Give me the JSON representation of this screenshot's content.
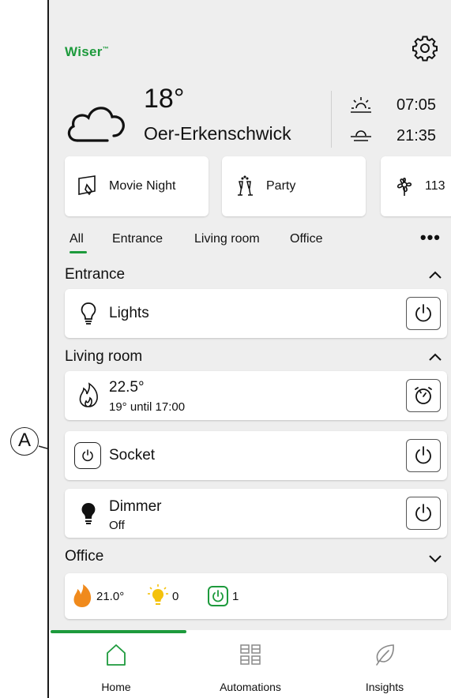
{
  "app": {
    "logo_text": "Wiser",
    "logo_tm": "™",
    "brand_color": "#1d9a3c"
  },
  "header": {
    "temperature": "18°",
    "city": "Oer-Erkenschwick",
    "sunrise": "07:05",
    "sunset": "21:35",
    "weather_icon": "cloud-icon"
  },
  "moments": [
    {
      "label": "Movie Night",
      "icon": "movie-night-icon"
    },
    {
      "label": "Party",
      "icon": "party-icon"
    },
    {
      "label": "113",
      "icon": "flower-icon"
    }
  ],
  "tabs": [
    "All",
    "Entrance",
    "Living room",
    "Office"
  ],
  "more_label": "•••",
  "sections": {
    "entrance": {
      "title": "Entrance",
      "lights": {
        "title": "Lights"
      }
    },
    "living_room": {
      "title": "Living room",
      "thermostat": {
        "title": "22.5°",
        "subtitle": "19° until 17:00"
      },
      "socket": {
        "title": "Socket"
      },
      "dimmer": {
        "title": "Dimmer",
        "subtitle": "Off"
      }
    },
    "office": {
      "title": "Office",
      "heating": "21.0°",
      "lights_on": "0",
      "sockets_on": "1"
    }
  },
  "nav": {
    "home": "Home",
    "automations": "Automations",
    "insights": "Insights"
  },
  "callout": {
    "label": "A"
  }
}
